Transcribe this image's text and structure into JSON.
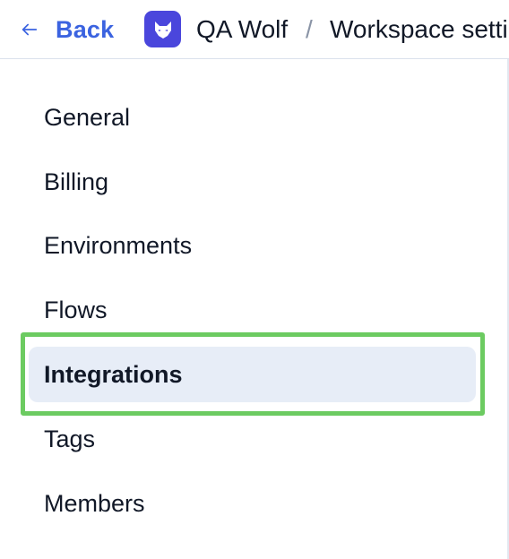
{
  "header": {
    "back_label": "Back",
    "org_name": "QA Wolf",
    "separator": "/",
    "page_title": "Workspace settings"
  },
  "nav": {
    "items": [
      {
        "label": "General",
        "active": false
      },
      {
        "label": "Billing",
        "active": false
      },
      {
        "label": "Environments",
        "active": false
      },
      {
        "label": "Flows",
        "active": false
      },
      {
        "label": "Integrations",
        "active": true
      },
      {
        "label": "Tags",
        "active": false
      },
      {
        "label": "Members",
        "active": false
      }
    ]
  },
  "colors": {
    "accent": "#3b63e0",
    "logo_bg": "#4a46dc",
    "active_bg": "#e7edf7",
    "highlight": "#6ccb61"
  },
  "icons": {
    "back": "arrow-left-icon",
    "logo": "wolf-logo-icon"
  }
}
